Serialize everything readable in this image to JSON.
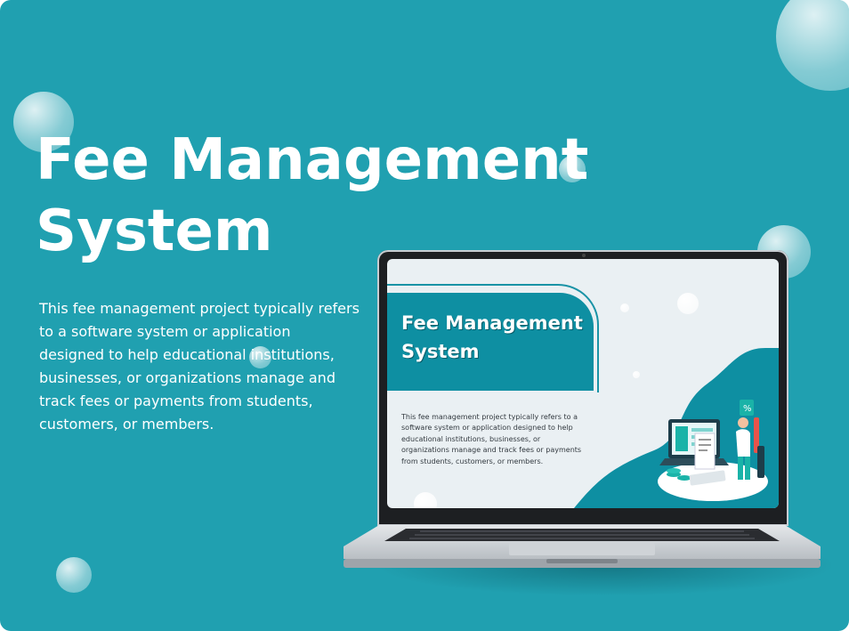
{
  "hero": {
    "title_line1": "Fee Management",
    "title_line2": "System",
    "description": "This fee management project typically refers to a software system or application designed to help educational institutions, businesses, or organizations manage and track fees or payments from students, customers, or members."
  },
  "screen_preview": {
    "title_line1": "Fee Management",
    "title_line2": "System",
    "description": "This fee management project typically refers to a software system or application designed to help educational institutions, businesses, or organizations manage and track fees or payments from students, customers, or members."
  },
  "icons": {
    "laptop": "laptop-icon",
    "illustration": "accountant-illustration-icon"
  },
  "colors": {
    "background": "#20a0b0",
    "screen_band": "#0e8fa2",
    "screen_bg": "#eaf0f3",
    "text": "#ffffff"
  }
}
